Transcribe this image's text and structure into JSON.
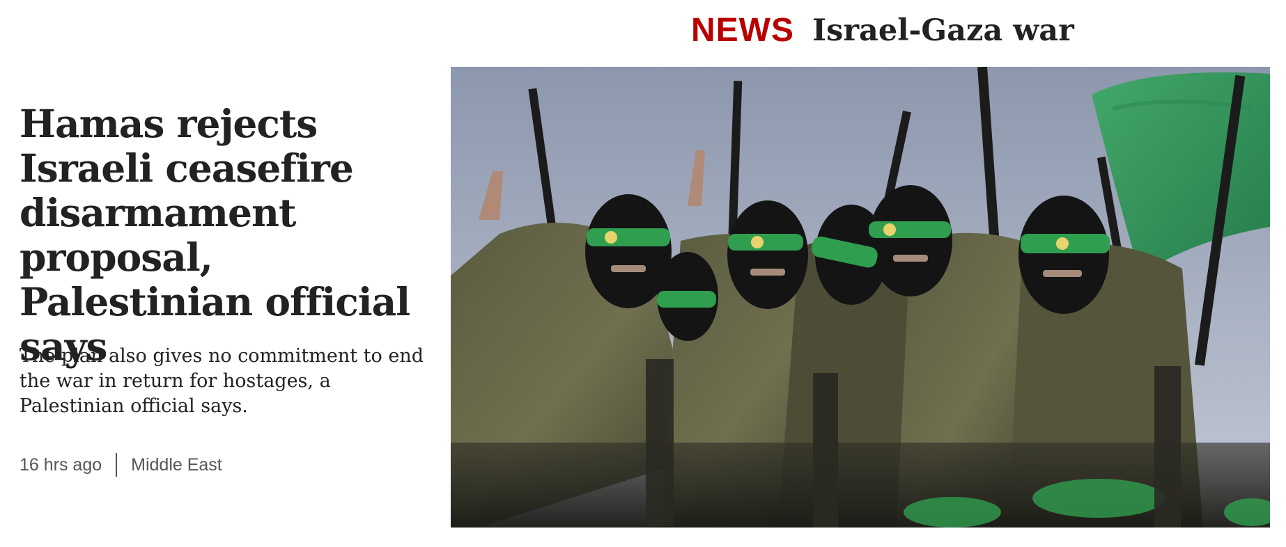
{
  "header": {
    "brand_label": "NEWS",
    "topic_label": "Israel-Gaza war"
  },
  "article": {
    "headline": "Hamas rejects Israeli ceasefire disarmament proposal, Palestinian official says",
    "summary": "The plan also gives no commitment to end the war in return for hostages, a Palestinian official says.",
    "timestamp": "16 hrs ago",
    "section_tag": "Middle East"
  },
  "colors": {
    "brand_red": "#b80000",
    "text_dark": "#202224",
    "text_muted": "#545658",
    "headband_green": "#2f9e4f"
  }
}
